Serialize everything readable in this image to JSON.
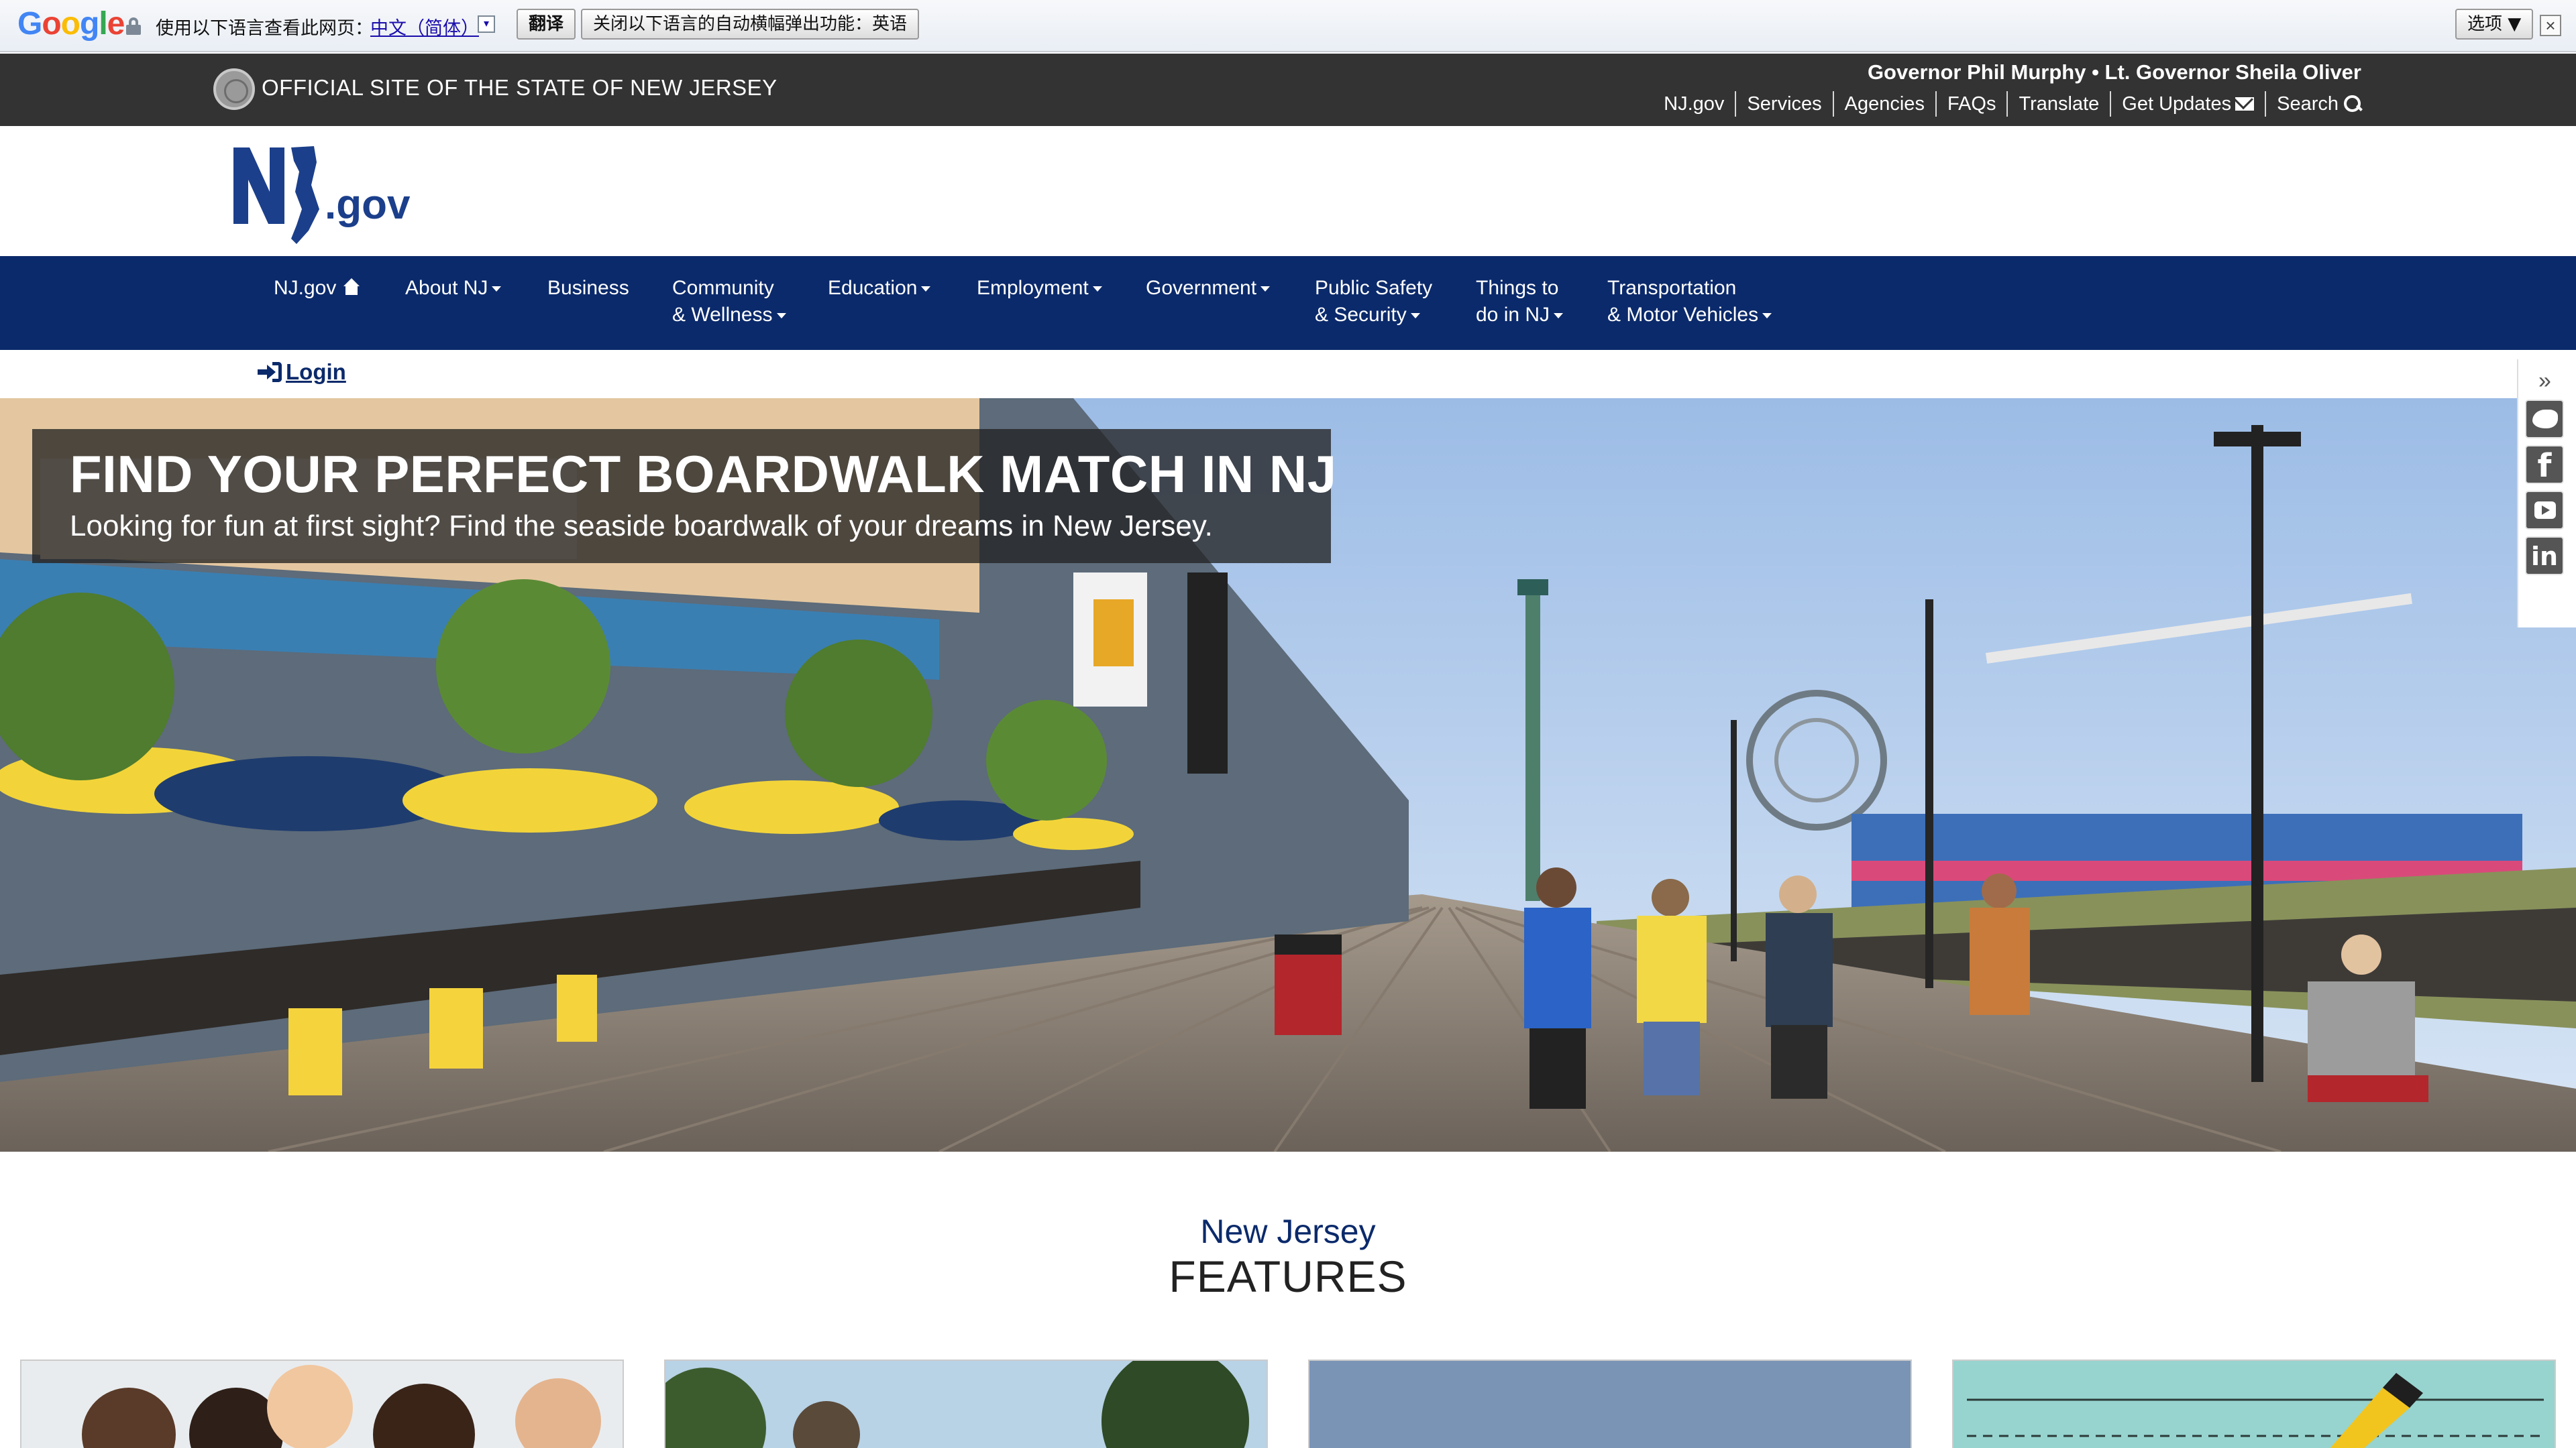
{
  "translate_bar": {
    "logo_text": "Google",
    "prompt": "使用以下语言查看此网页：",
    "language": "中文（简体）",
    "translate_button": "翻译",
    "never_button": "关闭以下语言的自动横幅弹出功能：英语",
    "options_button": "选项 ▼",
    "close_glyph": "×"
  },
  "state_bar": {
    "official_text": "OFFICIAL SITE OF THE STATE OF NEW JERSEY",
    "governor_text": "Governor Phil Murphy • Lt. Governor Sheila Oliver",
    "links": [
      {
        "label": "NJ.gov",
        "icon": ""
      },
      {
        "label": "Services",
        "icon": ""
      },
      {
        "label": "Agencies",
        "icon": ""
      },
      {
        "label": "FAQs",
        "icon": ""
      },
      {
        "label": "Translate",
        "icon": ""
      },
      {
        "label": "Get Updates",
        "icon": "envelope-icon"
      },
      {
        "label": "Search",
        "icon": "search-icon"
      }
    ]
  },
  "logo": {
    "letters": "NJ",
    "suffix": ".gov"
  },
  "nav": {
    "items": [
      {
        "line1": "NJ.gov",
        "line2": "",
        "icon": "home-icon",
        "dropdown": false
      },
      {
        "line1": "About NJ",
        "line2": "",
        "dropdown": true
      },
      {
        "line1": "Business",
        "line2": "",
        "dropdown": false
      },
      {
        "line1": "Community",
        "line2": "& Wellness",
        "dropdown": true
      },
      {
        "line1": "Education",
        "line2": "",
        "dropdown": true
      },
      {
        "line1": "Employment",
        "line2": "",
        "dropdown": true
      },
      {
        "line1": "Government",
        "line2": "",
        "dropdown": true
      },
      {
        "line1": "Public Safety",
        "line2": "& Security",
        "dropdown": true
      },
      {
        "line1": "Things to",
        "line2": "do in NJ",
        "dropdown": true
      },
      {
        "line1": "Transportation",
        "line2": "& Motor Vehicles",
        "dropdown": true
      }
    ]
  },
  "login": {
    "label": "Login"
  },
  "hero": {
    "title": "FIND YOUR PERFECT BOARDWALK MATCH IN NJ",
    "subtitle": "Looking for fun at first sight? Find the seaside boardwalk of your dreams in New Jersey."
  },
  "social": {
    "toggle": "»",
    "items": [
      "twitter-icon",
      "facebook-icon",
      "youtube-icon",
      "linkedin-icon"
    ]
  },
  "features": {
    "subtitle": "New Jersey",
    "title": "FEATURES"
  },
  "colors": {
    "nav_blue": "#0b2a6b",
    "state_bar": "#333333",
    "logo_blue": "#1b3f8b"
  }
}
